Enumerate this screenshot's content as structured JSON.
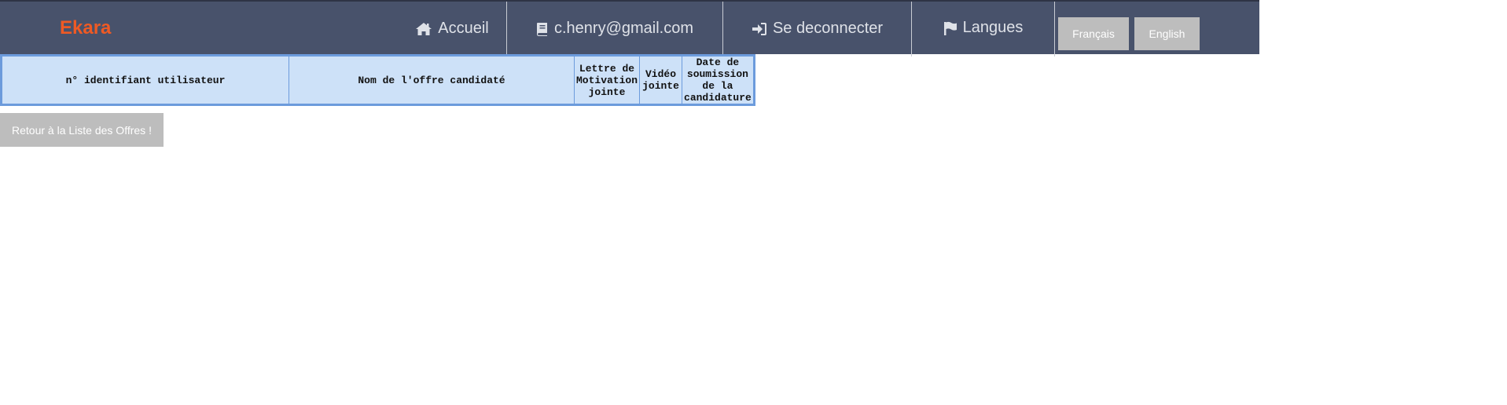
{
  "navbar": {
    "brand": "Ekara",
    "brand_color": "#ef5a24",
    "background": "#48526b",
    "items": [
      {
        "label": "Accueil",
        "icon": "home-icon"
      },
      {
        "label": "c.henry@gmail.com",
        "icon": "book-icon"
      },
      {
        "label": "Se deconnecter",
        "icon": "sign-in-icon"
      },
      {
        "label": "Langues",
        "icon": "flag-icon"
      }
    ],
    "languages": [
      "Français",
      "English"
    ]
  },
  "table": {
    "headers": [
      "n° identifiant utilisateur",
      "Nom de l'offre candidaté",
      "Lettre de Motivation jointe",
      "Vidéo jointe",
      "Date de soumission de la candidature"
    ],
    "rows": []
  },
  "back_button": {
    "label": "Retour à la Liste des Offres !"
  }
}
